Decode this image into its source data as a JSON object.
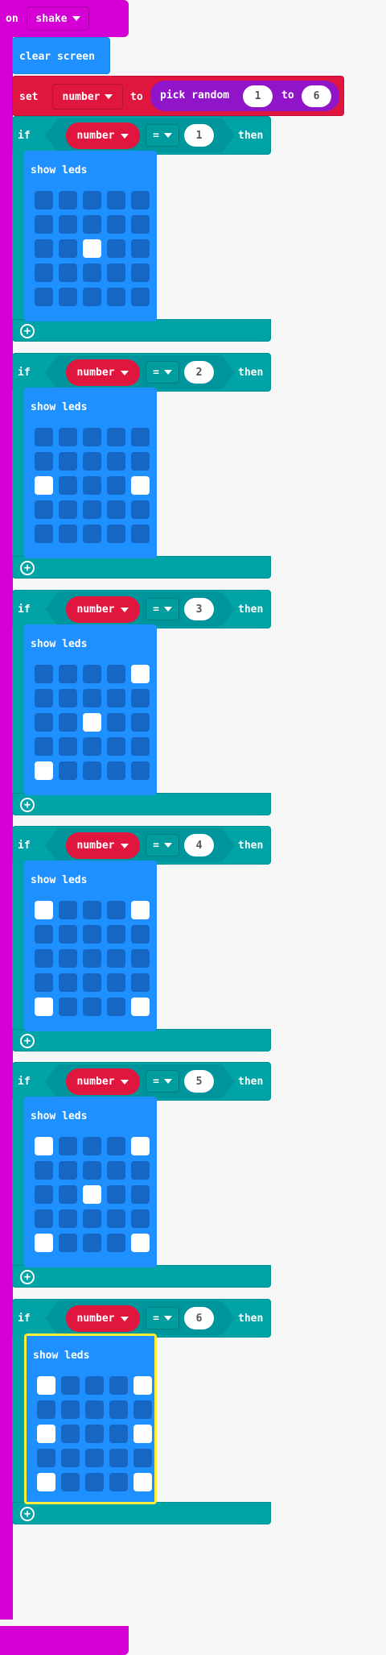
{
  "event": {
    "keyword": "on",
    "gesture": "shake"
  },
  "clear_screen": "clear screen",
  "set_block": {
    "keyword": "set",
    "variable": "number",
    "to": "to",
    "random": {
      "label": "pick random",
      "from": "1",
      "to_label": "to",
      "to": "6"
    }
  },
  "if_keyword": "if",
  "then_keyword": "then",
  "show_leds_label": "show leds",
  "colors": {
    "event": "#d400d4",
    "basic": "#1e90ff",
    "variables": "#e0163f",
    "math": "#9014c8",
    "logic": "#00a4a6",
    "selection": "#ffef3a"
  },
  "conditions": [
    {
      "variable": "number",
      "operator": "=",
      "value": "1",
      "leds": [
        [
          0,
          0,
          0,
          0,
          0
        ],
        [
          0,
          0,
          0,
          0,
          0
        ],
        [
          0,
          0,
          1,
          0,
          0
        ],
        [
          0,
          0,
          0,
          0,
          0
        ],
        [
          0,
          0,
          0,
          0,
          0
        ]
      ]
    },
    {
      "variable": "number",
      "operator": "=",
      "value": "2",
      "leds": [
        [
          0,
          0,
          0,
          0,
          0
        ],
        [
          0,
          0,
          0,
          0,
          0
        ],
        [
          1,
          0,
          0,
          0,
          1
        ],
        [
          0,
          0,
          0,
          0,
          0
        ],
        [
          0,
          0,
          0,
          0,
          0
        ]
      ]
    },
    {
      "variable": "number",
      "operator": "=",
      "value": "3",
      "leds": [
        [
          0,
          0,
          0,
          0,
          1
        ],
        [
          0,
          0,
          0,
          0,
          0
        ],
        [
          0,
          0,
          1,
          0,
          0
        ],
        [
          0,
          0,
          0,
          0,
          0
        ],
        [
          1,
          0,
          0,
          0,
          0
        ]
      ]
    },
    {
      "variable": "number",
      "operator": "=",
      "value": "4",
      "leds": [
        [
          1,
          0,
          0,
          0,
          1
        ],
        [
          0,
          0,
          0,
          0,
          0
        ],
        [
          0,
          0,
          0,
          0,
          0
        ],
        [
          0,
          0,
          0,
          0,
          0
        ],
        [
          1,
          0,
          0,
          0,
          1
        ]
      ]
    },
    {
      "variable": "number",
      "operator": "=",
      "value": "5",
      "leds": [
        [
          1,
          0,
          0,
          0,
          1
        ],
        [
          0,
          0,
          0,
          0,
          0
        ],
        [
          0,
          0,
          1,
          0,
          0
        ],
        [
          0,
          0,
          0,
          0,
          0
        ],
        [
          1,
          0,
          0,
          0,
          1
        ]
      ]
    },
    {
      "variable": "number",
      "operator": "=",
      "value": "6",
      "leds": [
        [
          1,
          0,
          0,
          0,
          1
        ],
        [
          0,
          0,
          0,
          0,
          0
        ],
        [
          1,
          0,
          0,
          0,
          1
        ],
        [
          0,
          0,
          0,
          0,
          0
        ],
        [
          1,
          0,
          0,
          0,
          1
        ]
      ]
    }
  ]
}
